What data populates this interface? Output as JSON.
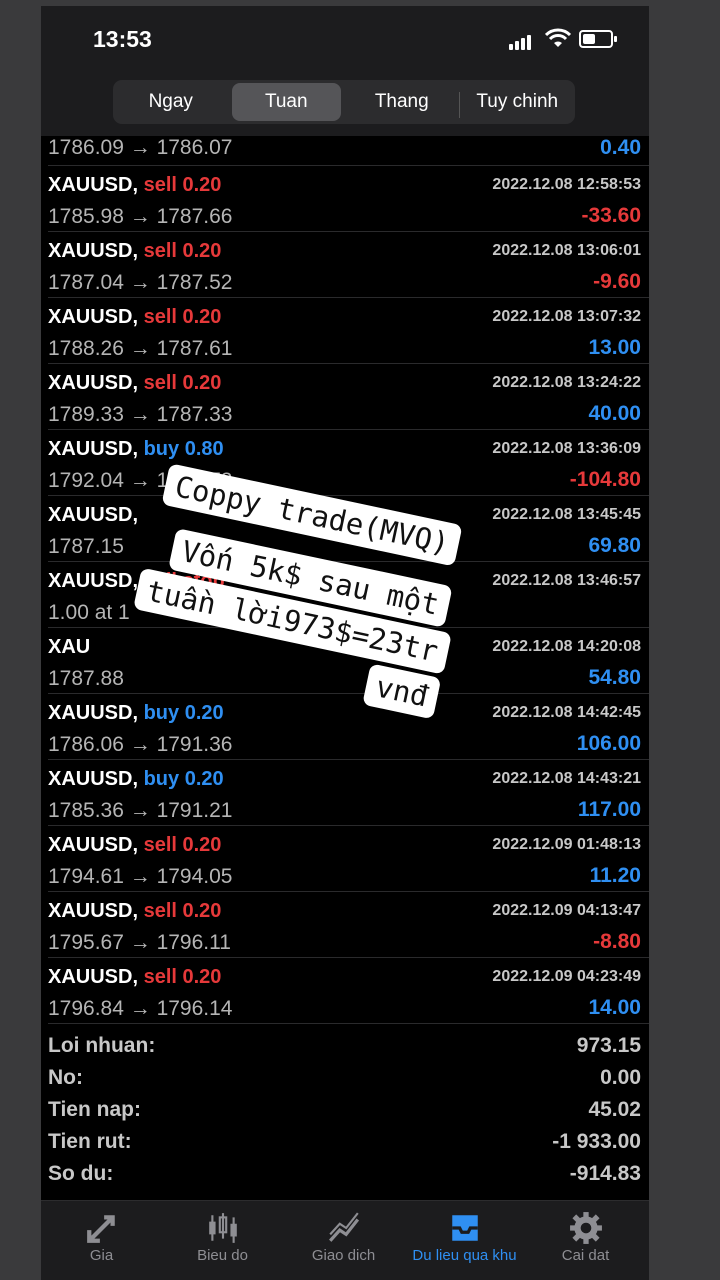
{
  "status": {
    "time": "13:53"
  },
  "segments": [
    {
      "label": "Ngay",
      "active": false
    },
    {
      "label": "Tuan",
      "active": true
    },
    {
      "label": "Thang",
      "active": false
    },
    {
      "label": "Tuy chinh",
      "active": false
    }
  ],
  "trades": [
    {
      "symbol": "",
      "side": "",
      "lot": "",
      "datetime": "",
      "prices": "1786.09 → 1786.07",
      "profit": "0.40",
      "sign": "pos"
    },
    {
      "symbol": "XAUUSD,",
      "side": "sell",
      "lot": "0.20",
      "datetime": "2022.12.08 12:58:53",
      "prices": "1785.98 → 1787.66",
      "profit": "-33.60",
      "sign": "neg"
    },
    {
      "symbol": "XAUUSD,",
      "side": "sell",
      "lot": "0.20",
      "datetime": "2022.12.08 13:06:01",
      "prices": "1787.04 → 1787.52",
      "profit": "-9.60",
      "sign": "neg"
    },
    {
      "symbol": "XAUUSD,",
      "side": "sell",
      "lot": "0.20",
      "datetime": "2022.12.08 13:07:32",
      "prices": "1788.26 → 1787.61",
      "profit": "13.00",
      "sign": "pos"
    },
    {
      "symbol": "XAUUSD,",
      "side": "sell",
      "lot": "0.20",
      "datetime": "2022.12.08 13:24:22",
      "prices": "1789.33 → 1787.33",
      "profit": "40.00",
      "sign": "pos"
    },
    {
      "symbol": "XAUUSD,",
      "side": "buy",
      "lot": "0.80",
      "datetime": "2022.12.08 13:36:09",
      "prices": "1792.04 → 1790.73",
      "profit": "-104.80",
      "sign": "neg"
    },
    {
      "symbol": "XAUUSD,",
      "side": "",
      "lot": "",
      "datetime": "2022.12.08 13:45:45",
      "prices": "1787.15",
      "profit": "69.80",
      "sign": "pos"
    },
    {
      "symbol": "XAUUSD,",
      "side": "sell stop",
      "lot": "",
      "datetime": "2022.12.08 13:46:57",
      "prices": "1.00 at 1",
      "profit": "",
      "sign": "pos"
    },
    {
      "symbol": "XAU",
      "side": "",
      "lot": "",
      "datetime": "2022.12.08 14:20:08",
      "prices": "1787.88",
      "profit": "54.80",
      "sign": "pos"
    },
    {
      "symbol": "XAUUSD,",
      "side": "buy",
      "lot": "0.20",
      "datetime": "2022.12.08 14:42:45",
      "prices": "1786.06 → 1791.36",
      "profit": "106.00",
      "sign": "pos"
    },
    {
      "symbol": "XAUUSD,",
      "side": "buy",
      "lot": "0.20",
      "datetime": "2022.12.08 14:43:21",
      "prices": "1785.36 → 1791.21",
      "profit": "117.00",
      "sign": "pos"
    },
    {
      "symbol": "XAUUSD,",
      "side": "sell",
      "lot": "0.20",
      "datetime": "2022.12.09 01:48:13",
      "prices": "1794.61 → 1794.05",
      "profit": "11.20",
      "sign": "pos"
    },
    {
      "symbol": "XAUUSD,",
      "side": "sell",
      "lot": "0.20",
      "datetime": "2022.12.09 04:13:47",
      "prices": "1795.67 → 1796.11",
      "profit": "-8.80",
      "sign": "neg"
    },
    {
      "symbol": "XAUUSD,",
      "side": "sell",
      "lot": "0.20",
      "datetime": "2022.12.09 04:23:49",
      "prices": "1796.84 → 1796.14",
      "profit": "14.00",
      "sign": "pos"
    }
  ],
  "summary": [
    {
      "label": "Loi nhuan:",
      "value": "973.15"
    },
    {
      "label": "No:",
      "value": "0.00"
    },
    {
      "label": "Tien nap:",
      "value": "45.02"
    },
    {
      "label": "Tien rut:",
      "value": "-1 933.00"
    },
    {
      "label": "So du:",
      "value": "-914.83"
    }
  ],
  "overlay": {
    "line1": "Coppy trade(MVQ)",
    "line2": "Vốn 5k$ sau một",
    "line3": "tuần lời973$=23tr",
    "line4": "vnđ"
  },
  "tabs": [
    {
      "label": "Gia",
      "icon": "price-arrows-icon",
      "active": false
    },
    {
      "label": "Bieu do",
      "icon": "candlestick-icon",
      "active": false
    },
    {
      "label": "Giao dich",
      "icon": "trade-chart-icon",
      "active": false
    },
    {
      "label": "Du lieu qua khu",
      "icon": "history-tray-icon",
      "active": true
    },
    {
      "label": "Cai dat",
      "icon": "gear-icon",
      "active": false
    }
  ],
  "colors": {
    "sell": "#e6393a",
    "buy": "#2f8ff2",
    "accent": "#2f8ff2",
    "background": "#000000"
  }
}
